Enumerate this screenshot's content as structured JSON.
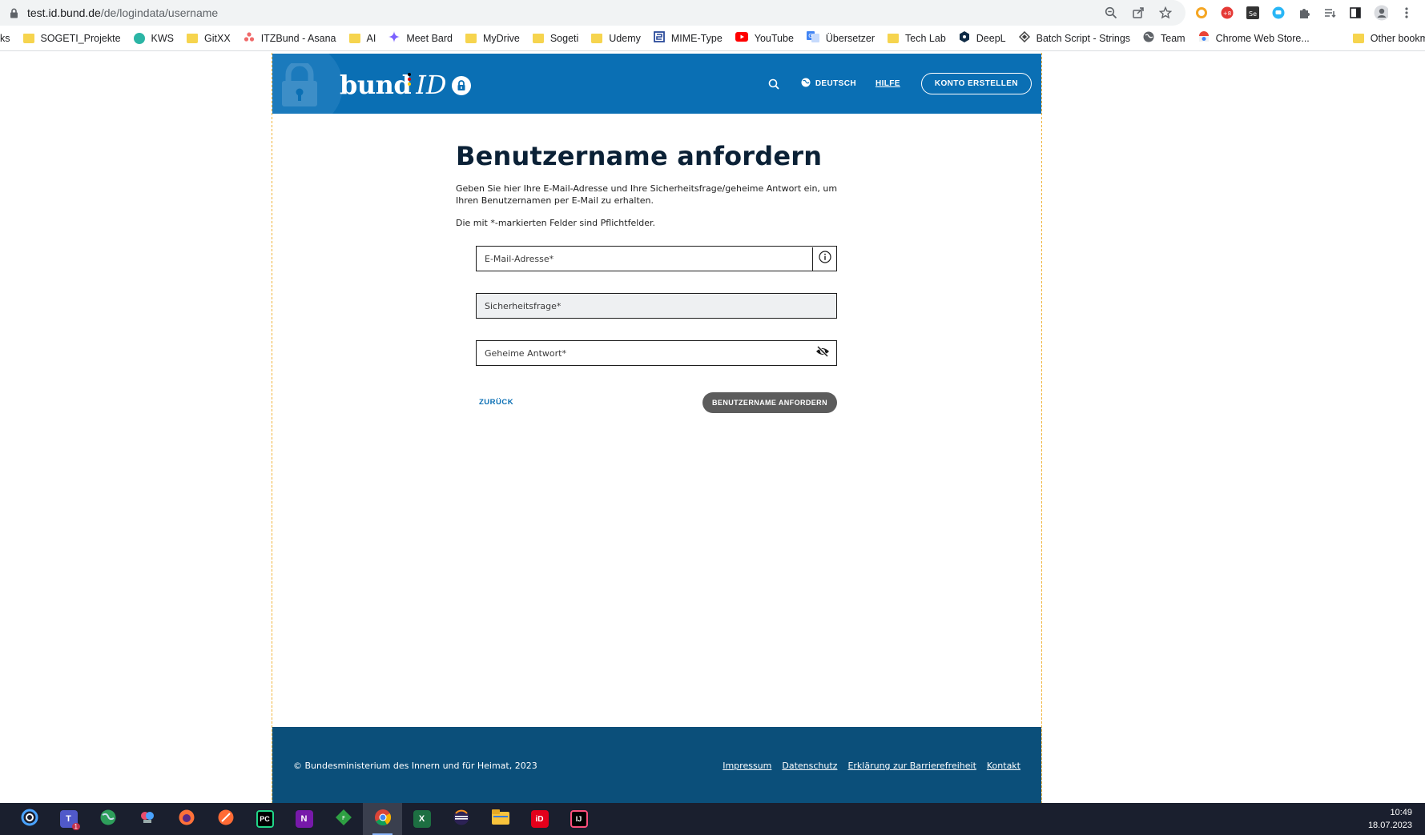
{
  "browser": {
    "url_host": "test.id.bund.de",
    "url_path": "/de/logindata/username",
    "bookmarks": [
      {
        "label": "ks",
        "icon": "folder-partial"
      },
      {
        "label": "SOGETI_Projekte",
        "icon": "folder-icon"
      },
      {
        "label": "KWS",
        "icon": "kws-icon"
      },
      {
        "label": "GitXX",
        "icon": "folder-icon"
      },
      {
        "label": "ITZBund - Asana",
        "icon": "asana-icon"
      },
      {
        "label": "AI",
        "icon": "folder-icon"
      },
      {
        "label": "Meet Bard",
        "icon": "bard-icon"
      },
      {
        "label": "MyDrive",
        "icon": "folder-icon"
      },
      {
        "label": "Sogeti",
        "icon": "folder-icon"
      },
      {
        "label": "Udemy",
        "icon": "folder-icon"
      },
      {
        "label": "MIME-Type",
        "icon": "mime-icon"
      },
      {
        "label": "YouTube",
        "icon": "youtube-icon"
      },
      {
        "label": "Übersetzer",
        "icon": "translate-icon"
      },
      {
        "label": "Tech Lab",
        "icon": "folder-icon"
      },
      {
        "label": "DeepL",
        "icon": "deepl-icon"
      },
      {
        "label": "Batch Script - Strings",
        "icon": "batch-icon"
      },
      {
        "label": "Team",
        "icon": "globe-icon"
      },
      {
        "label": "Chrome Web Store...",
        "icon": "webstore-icon"
      }
    ],
    "other_bookmarks": "Other bookmarks"
  },
  "header": {
    "brand_bund": "bund",
    "brand_id": "ID",
    "language": "DEUTSCH",
    "help": "HILFE",
    "create_account": "KONTO ERSTELLEN"
  },
  "main": {
    "title": "Benutzername anfordern",
    "intro": "Geben Sie hier Ihre E-Mail-Adresse und Ihre Sicherheitsfrage/geheime Antwort ein, um Ihren Benutzernamen per E-Mail zu erhalten.",
    "required_note": "Die mit *-markierten Felder sind Pflichtfelder.",
    "fields": {
      "email": "E-Mail-Adresse*",
      "security_question": "Sicherheitsfrage*",
      "secret_answer": "Geheime Antwort*"
    },
    "back": "ZURÜCK",
    "submit": "BENUTZERNAME ANFORDERN"
  },
  "footer": {
    "copyright": "© Bundesministerium des Innern und für Heimat, 2023",
    "links": [
      "Impressum",
      "Datenschutz",
      "Erklärung zur Barrierefreiheit",
      "Kontakt"
    ]
  },
  "taskbar": {
    "time": "10:49",
    "date": "18.07.2023",
    "teams_badge": "1"
  },
  "colors": {
    "header_blue": "#0a6fb4",
    "footer_blue": "#0b4f7a",
    "title_color": "#0b2136",
    "submit_grey": "#5c5c5c"
  }
}
